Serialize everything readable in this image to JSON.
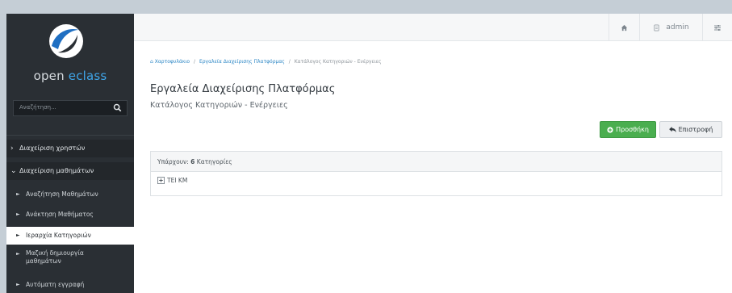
{
  "sidebar": {
    "brand_prefix": "open ",
    "brand_accent": "eclass",
    "search_placeholder": "Αναζήτηση...",
    "sections": [
      {
        "label": "Διαχείριση χρηστών",
        "expanded": false
      },
      {
        "label": "Διαχείριση μαθημάτων",
        "expanded": true
      }
    ],
    "items": [
      {
        "label": "Αναζήτηση Μαθημάτων"
      },
      {
        "label": "Ανάκτηση Μαθήματος"
      },
      {
        "label": "Ιεραρχία Κατηγοριών",
        "active": true
      },
      {
        "label": "Μαζική δημιουργία"
      },
      {
        "label": "μαθημάτων"
      },
      {
        "label": "Αυτόματη εγγραφή"
      }
    ]
  },
  "topbar": {
    "home_icon": "home-icon",
    "user_label": "admin",
    "user_icon": "user-icon",
    "settings_icon": "sliders-icon"
  },
  "breadcrumb": {
    "items": [
      "Χαρτοφυλάκιο",
      "Εργαλεία Διαχείρισης Πλατφόρμας",
      "Κατάλογος Κατηγοριών - Ενέργειες"
    ],
    "separator": "/"
  },
  "page": {
    "title": "Εργαλεία Διαχείρισης Πλατφόρμας",
    "subtitle": "Κατάλογος Κατηγοριών - Ενέργειες"
  },
  "actions": {
    "add_label": "Προσθήκη",
    "back_label": "Επιστροφή"
  },
  "categories_panel": {
    "prefix": "Υπάρχουν: ",
    "count": "6",
    "suffix": " Κατηγορίες",
    "tree": [
      {
        "label": "ΤΕΙ ΚΜ"
      }
    ]
  },
  "colors": {
    "sidebar_bg": "#2a2f34",
    "accent_blue": "#3fa5e8",
    "success_green": "#4aae4f",
    "link_blue": "#2b86c5"
  }
}
